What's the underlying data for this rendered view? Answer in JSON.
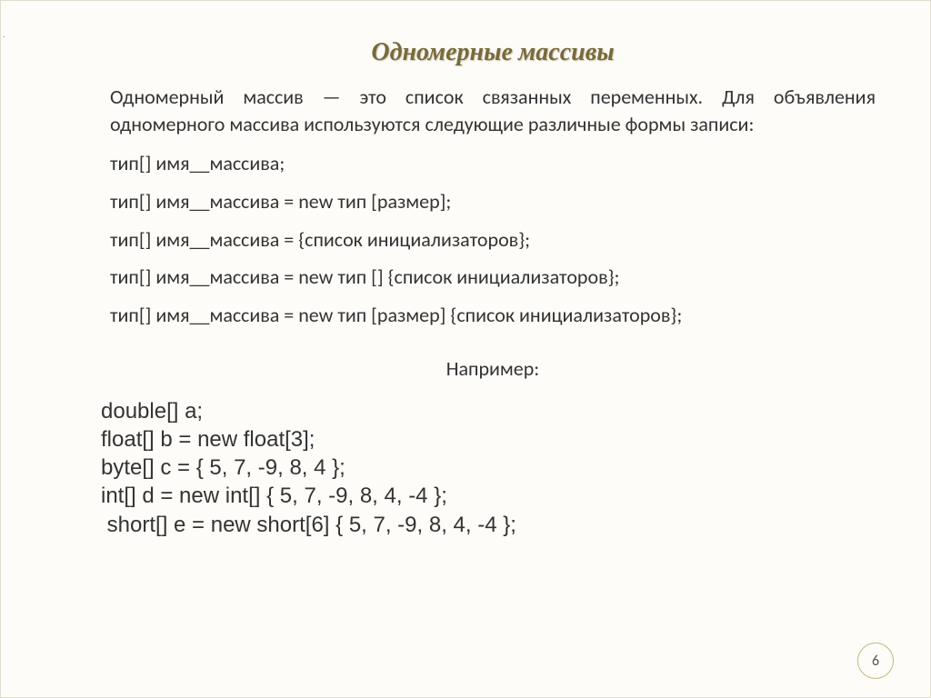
{
  "title": "Одномерные массивы",
  "intro": "Одномерный массив — это список связанных переменных. Для объявления одномерного массива используются следующие различные формы записи:",
  "syntax": [
    "тип[] имя__массива;",
    "тип[] имя__массива = new тип [размер];",
    "тип[] имя__массива = {список инициализаторов};",
    "тип[] имя__массива = new тип [] {список инициализаторов};",
    "тип[] имя__массива = new тип [размер] {список инициализаторов};"
  ],
  "example_label": "Например:",
  "code": [
    "double[] a;",
    "float[] b = new float[3];",
    "byte[] c = { 5, 7, -9, 8, 4 };",
    "int[] d = new int[] { 5, 7, -9, 8, 4, -4 };",
    " short[] e = new short[6] { 5, 7, -9, 8, 4, -4 };"
  ],
  "page_number": "6",
  "edge_marker": "."
}
